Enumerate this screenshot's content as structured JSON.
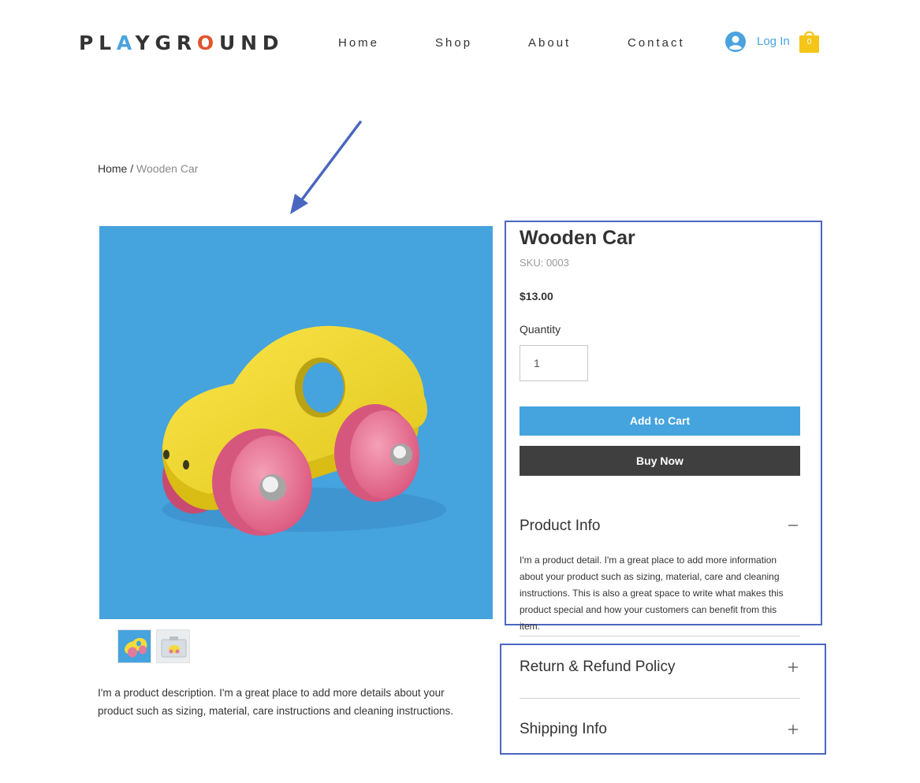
{
  "header": {
    "logo": {
      "part1": "PL",
      "letter_a": "A",
      "part2": "YGR",
      "letter_o": "O",
      "part3": "UND"
    },
    "nav": [
      {
        "label": "Home"
      },
      {
        "label": "Shop"
      },
      {
        "label": "About"
      },
      {
        "label": "Contact"
      }
    ],
    "login_label": "Log In",
    "cart_count": "0",
    "colors": {
      "accent_blue": "#4aa3df",
      "accent_red": "#e2532d",
      "cart_yellow": "#f5c518"
    }
  },
  "breadcrumb": {
    "home": "Home",
    "separator": " / ",
    "current": "Wooden Car"
  },
  "product": {
    "name": "Wooden Car",
    "sku": "SKU: 0003",
    "price": "$13.00",
    "quantity_label": "Quantity",
    "quantity_value": "1",
    "add_to_cart_label": "Add to Cart",
    "buy_now_label": "Buy Now",
    "description": "I'm a product description. I'm a great place to add more details about your product such as sizing, material, care instructions and cleaning instructions.",
    "image_alt_icon": "wooden-car-photo",
    "thumbnails": [
      {
        "icon": "wooden-car-thumbnail"
      },
      {
        "icon": "boxed-car-thumbnail"
      }
    ],
    "colors": {
      "image_bg": "#45a3de",
      "add_to_cart": "#45a3de",
      "buy_now": "#3f3f3f"
    }
  },
  "sections": {
    "product_info": {
      "title": "Product Info",
      "toggle_icon": "minus-icon",
      "text": "I'm a product detail. I'm a great place to add more information about your product such as sizing, material, care and cleaning instructions. This is also a great space to write what makes this product special and how your customers can benefit from this item."
    },
    "return_policy": {
      "title": "Return & Refund Policy",
      "toggle_icon": "plus-icon"
    },
    "shipping_info": {
      "title": "Shipping Info",
      "toggle_icon": "plus-icon"
    }
  },
  "annotations": {
    "highlight_color": "#4a67c0",
    "arrow_icon": "pointer-arrow"
  }
}
